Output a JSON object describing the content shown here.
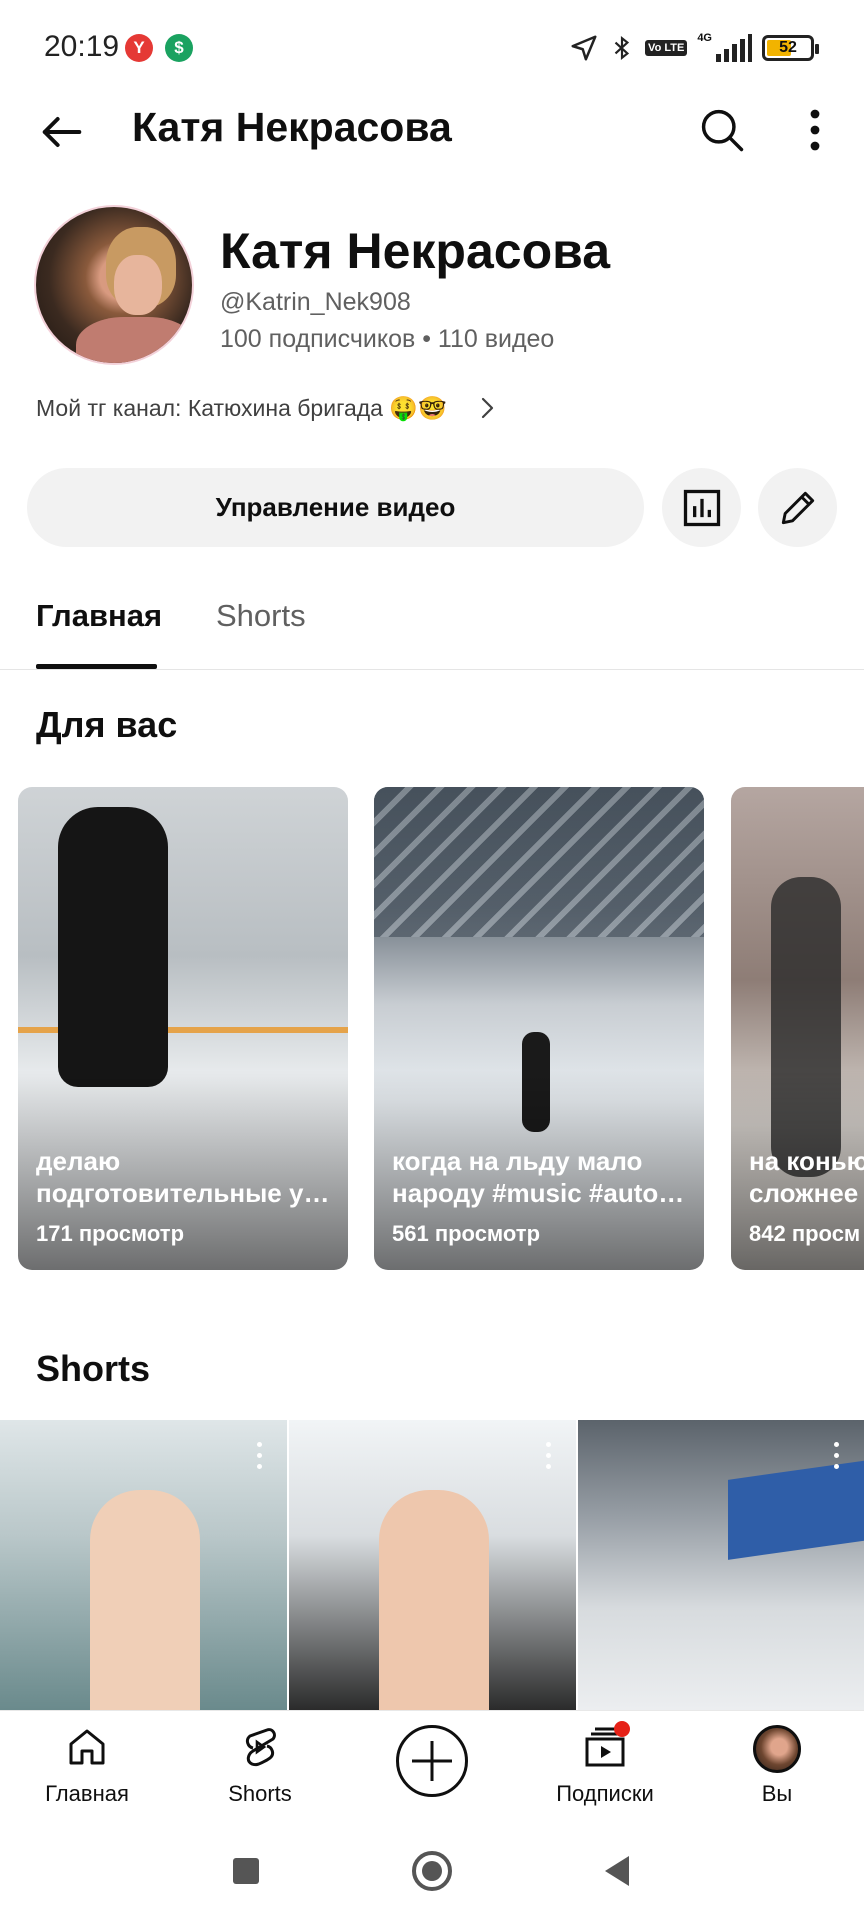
{
  "status_bar": {
    "time": "20:19",
    "notif_y": "Y",
    "notif_g": "$",
    "network": "4G",
    "volte": "Vo LTE",
    "battery": "52"
  },
  "app_bar": {
    "title": "Катя Некрасова"
  },
  "channel": {
    "name": "Катя Некрасова",
    "handle": "@Katrin_Nek908",
    "stats": "100 подписчиков • 110 видео",
    "description": "Мой тг канал:  Катюхина бригада 🤑🤓"
  },
  "actions": {
    "manage_label": "Управление видео"
  },
  "tabs": [
    {
      "label": "Главная",
      "selected": true
    },
    {
      "label": "Shorts",
      "selected": false
    }
  ],
  "for_you": {
    "title": "Для вас",
    "cards": [
      {
        "title": "делаю\nподготовительные у…",
        "views": "171 просмотр"
      },
      {
        "title": "когда на льду мало\nнароду #music #auto…",
        "views": "561 просмотр"
      },
      {
        "title": "на конью\nсложнее",
        "views": "842 просм"
      }
    ]
  },
  "shorts": {
    "title": "Shorts",
    "tiles": 3
  },
  "bottom_nav": {
    "home": "Главная",
    "shorts": "Shorts",
    "subscriptions": "Подписки",
    "you": "Вы"
  },
  "colors": {
    "accent_red": "#e62117",
    "chip_bg": "#f2f2f2",
    "text_primary": "#0f0f0f",
    "text_secondary": "#606060"
  }
}
